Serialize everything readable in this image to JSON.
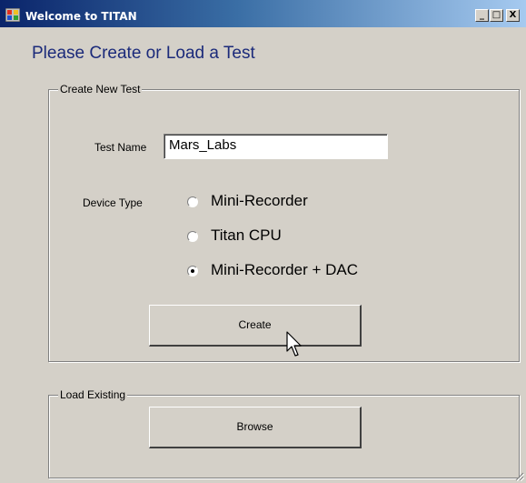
{
  "window": {
    "title": "Welcome to TITAN"
  },
  "titlebar_buttons": {
    "minimize": "_",
    "maximize": "□",
    "close": "X"
  },
  "heading": "Please Create or Load a Test",
  "create_group": {
    "label": "Create New Test",
    "test_name_label": "Test Name",
    "test_name_value": "Mars_Labs",
    "device_type_label": "Device Type",
    "device_options": [
      {
        "label": "Mini-Recorder",
        "selected": false
      },
      {
        "label": "Titan CPU",
        "selected": false
      },
      {
        "label": "Mini-Recorder + DAC",
        "selected": true
      }
    ],
    "create_button": "Create"
  },
  "load_group": {
    "label": "Load Existing",
    "browse_button": "Browse"
  },
  "icons": [
    "app-icon",
    "mouse-cursor-icon",
    "resize-grip-icon"
  ]
}
